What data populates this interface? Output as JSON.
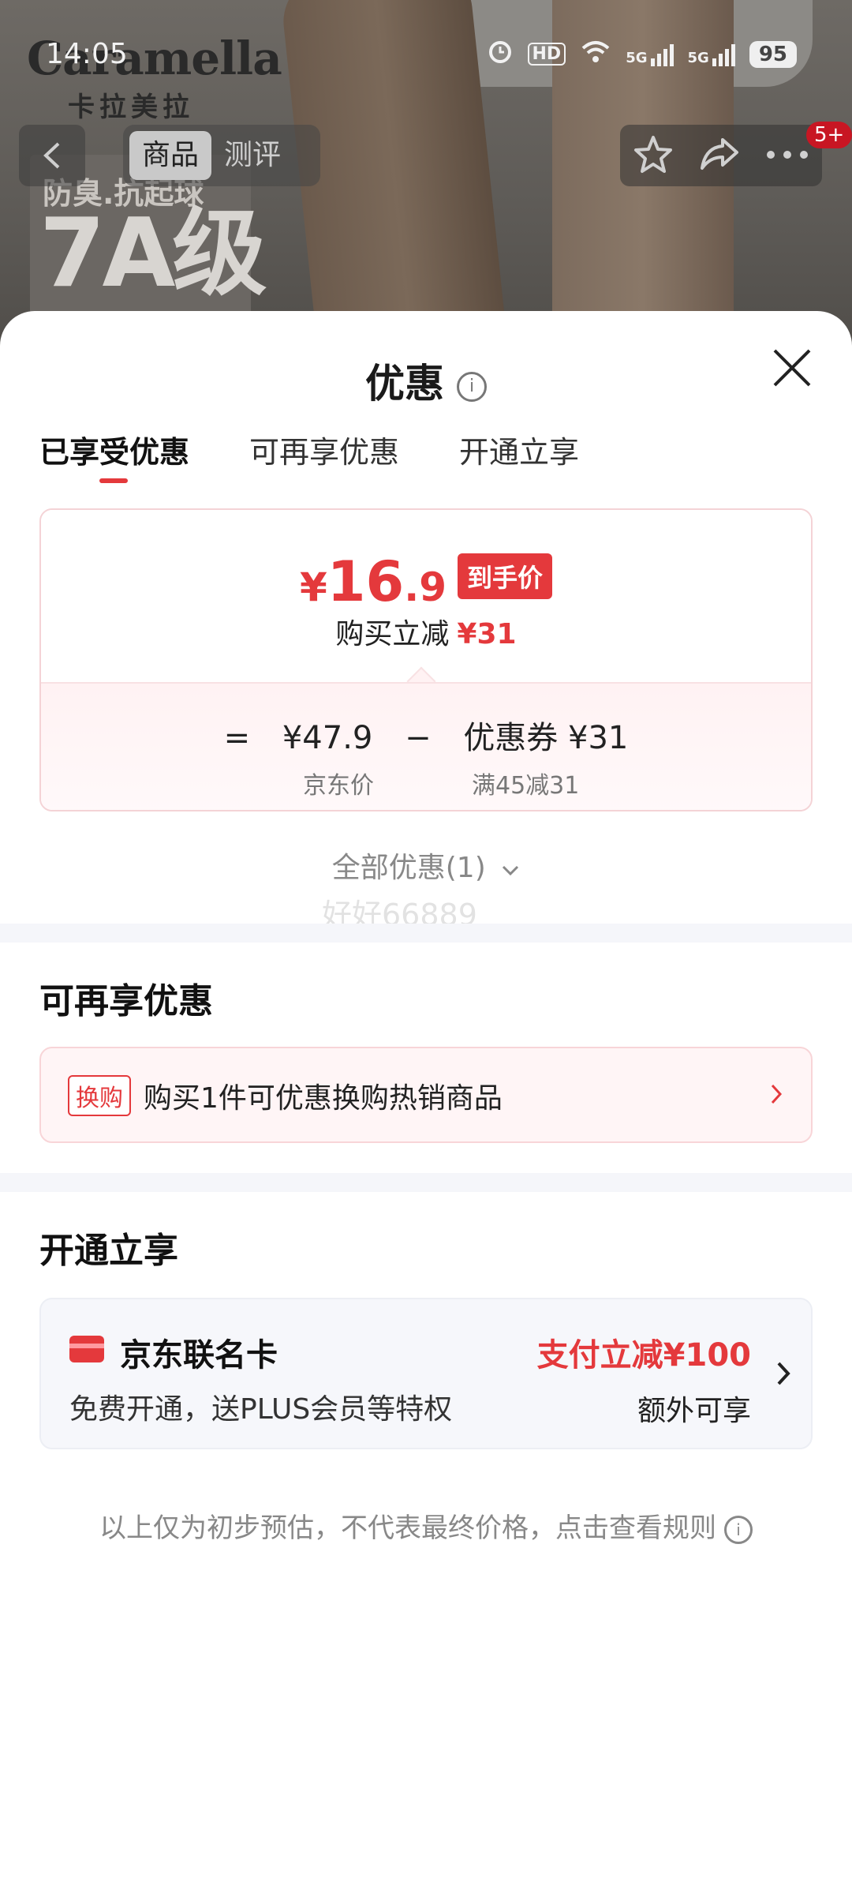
{
  "status_bar": {
    "time": "14:05",
    "hd_label": "HD",
    "net_label_1": "5G",
    "net_label_2": "5G",
    "battery": "95"
  },
  "background": {
    "brand": "Caramella",
    "brand_sub": "卡拉美拉",
    "promo_line1": "防臭.抗起球",
    "promo_line2": "7A级"
  },
  "top_nav": {
    "tabs": [
      "商品",
      "测评"
    ],
    "message_badge": "5+"
  },
  "sheet": {
    "title": "优惠",
    "tabs": [
      "已享受优惠",
      "可再享优惠",
      "开通立享"
    ],
    "price": {
      "currency": "¥",
      "final_int": "16",
      "final_dec": ".9",
      "final_tag": "到手价",
      "reduce_label": "购买立减",
      "reduce_value": "¥31",
      "equals": "=",
      "base_price": "¥47.9",
      "minus": "−",
      "coupon_label": "优惠券 ¥31",
      "base_caption": "京东价",
      "coupon_caption": "满45减31"
    },
    "all_deals": "全部优惠(1)",
    "watermark": "好好66889",
    "more_section": {
      "title": "可再享优惠",
      "tag": "换购",
      "text": "购买1件可优惠换购热销商品"
    },
    "open_section": {
      "title": "开通立享",
      "card_name": "京东联名卡",
      "card_desc": "免费开通，送PLUS会员等特权",
      "offer": "支付立减¥100",
      "offer_extra": "额外可享"
    },
    "footer": "以上仅为初步预估，不代表最终价格，点击查看规则"
  },
  "colors": {
    "accent": "#e4393c"
  }
}
